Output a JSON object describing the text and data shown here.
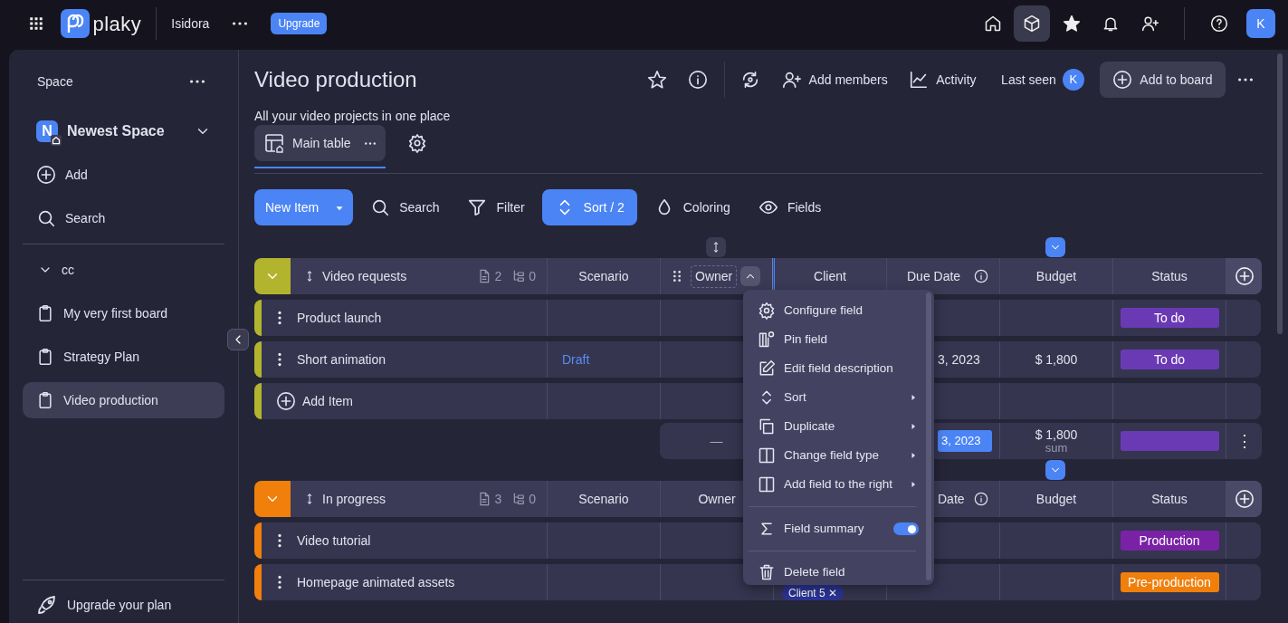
{
  "topbar": {
    "logo_text": "plaky",
    "workspace": "Isidora",
    "upgrade": "Upgrade",
    "avatar": "K",
    "nav": [
      {
        "kind": "home",
        "selected": false
      },
      {
        "kind": "cube",
        "selected": true
      },
      {
        "kind": "star",
        "selected": false
      },
      {
        "kind": "bell",
        "selected": false
      },
      {
        "kind": "user-plus",
        "selected": false
      }
    ]
  },
  "sidebar": {
    "heading": "Space",
    "space": {
      "initial": "N",
      "name": "Newest Space"
    },
    "actions": [
      {
        "kind": "add",
        "label": "Add"
      },
      {
        "kind": "search",
        "label": "Search"
      }
    ],
    "folder": {
      "name": "cc",
      "expanded": true,
      "boards": [
        {
          "name": "My very first board",
          "selected": false
        },
        {
          "name": "Strategy Plan",
          "selected": false
        },
        {
          "name": "Video production",
          "selected": true
        }
      ]
    },
    "upgrade": "Upgrade your plan"
  },
  "header": {
    "title": "Video production",
    "subtitle": "All your video projects in one place",
    "add_members": "Add members",
    "activity": "Activity",
    "last_seen": "Last seen",
    "last_seen_avatar": "K",
    "add_to_board": "Add to board"
  },
  "views": [
    {
      "label": "Main table",
      "selected": true
    }
  ],
  "toolbar": {
    "new_item": "New Item",
    "tools": [
      {
        "kind": "search",
        "label": "Search",
        "active": false
      },
      {
        "kind": "filter",
        "label": "Filter",
        "active": false
      },
      {
        "kind": "sort",
        "label": "Sort / 2",
        "active": true
      },
      {
        "kind": "coloring",
        "label": "Coloring",
        "active": false
      },
      {
        "kind": "fields",
        "label": "Fields",
        "active": false
      }
    ]
  },
  "groups": [
    {
      "name": "Video requests",
      "color": "#b2b42e",
      "item_count": "2",
      "subitem_count": "0",
      "expanded": true,
      "columns": [
        {
          "label": "Scenario"
        },
        {
          "label": "Owner",
          "menu_open": true
        },
        {
          "label": "Client"
        },
        {
          "label": "Due Date",
          "info": true
        },
        {
          "label": "Budget"
        },
        {
          "label": "Status"
        }
      ],
      "rows": [
        {
          "name": "Product launch",
          "cells": [
            null,
            null,
            null,
            null,
            null,
            {
              "kind": "status",
              "text": "To do",
              "color": "#6a3ab5"
            }
          ]
        },
        {
          "name": "Short animation",
          "cells": [
            {
              "kind": "link",
              "text": "Draft"
            },
            null,
            null,
            {
              "kind": "text",
              "text": "3, 2023"
            },
            {
              "kind": "text",
              "text": "$ 1,800"
            },
            {
              "kind": "status",
              "text": "To do",
              "color": "#6a3ab5"
            }
          ]
        }
      ],
      "add_item": "Add Item",
      "summary": {
        "more": "⋮",
        "cells": [
          null,
          {
            "kind": "text",
            "text": "—"
          },
          null,
          {
            "kind": "date",
            "text": "3, 2023"
          },
          {
            "kind": "sum",
            "text": "$ 1,800",
            "caption": "sum"
          },
          {
            "kind": "bar",
            "color": "#6a3ab5"
          }
        ]
      }
    },
    {
      "name": "In progress",
      "color": "#f07f0c",
      "item_count": "3",
      "subitem_count": "0",
      "expanded": true,
      "columns": [
        {
          "label": "Scenario"
        },
        {
          "label": "Owner"
        },
        null,
        {
          "label": "Date",
          "info": true
        },
        {
          "label": "Budget"
        },
        {
          "label": "Status"
        }
      ],
      "rows": [
        {
          "name": "Video tutorial",
          "cells": [
            null,
            null,
            null,
            null,
            null,
            {
              "kind": "status",
              "text": "Production",
              "color": "#7a22a6"
            }
          ]
        },
        {
          "name": "Homepage animated assets",
          "cells": [
            null,
            null,
            {
              "kind": "tag",
              "text": "Client 5",
              "remove": "✕",
              "color": "#2b3495"
            },
            null,
            null,
            {
              "kind": "status",
              "text": "Pre-production",
              "color": "#f07f0c"
            }
          ]
        }
      ]
    }
  ],
  "field_menu": [
    {
      "kind": "item",
      "label": "Configure field",
      "submenu": false
    },
    {
      "kind": "item",
      "label": "Pin field",
      "submenu": false
    },
    {
      "kind": "item",
      "label": "Edit field description",
      "submenu": false
    },
    {
      "kind": "item",
      "label": "Sort",
      "submenu": true
    },
    {
      "kind": "item",
      "label": "Duplicate",
      "submenu": true
    },
    {
      "kind": "item",
      "label": "Change field type",
      "submenu": true
    },
    {
      "kind": "item",
      "label": "Add field to the right",
      "submenu": true
    },
    {
      "kind": "divider"
    },
    {
      "kind": "toggle",
      "label": "Field summary",
      "on": true
    },
    {
      "kind": "divider"
    },
    {
      "kind": "item",
      "label": "Delete field",
      "submenu": false
    }
  ]
}
